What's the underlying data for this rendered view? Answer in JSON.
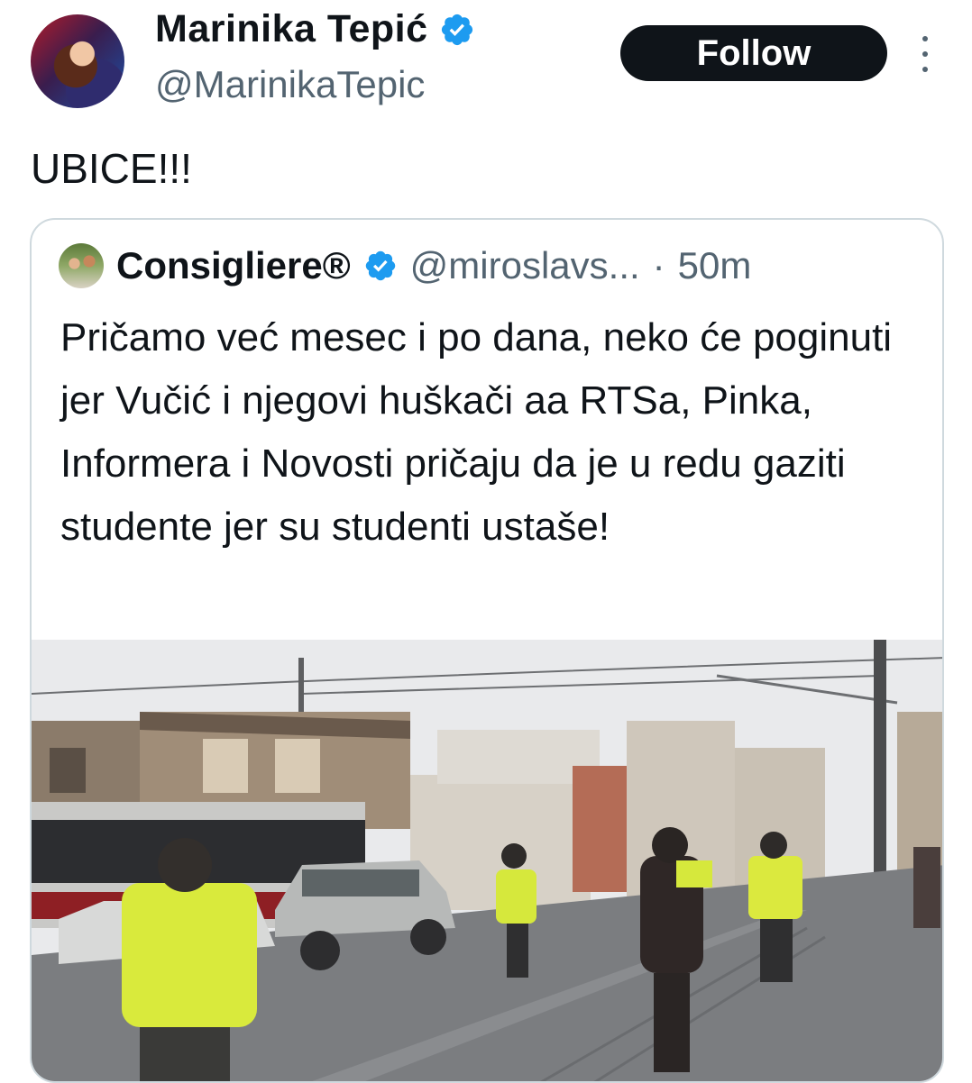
{
  "author": {
    "name": "Marinika Tepić",
    "handle": "@MarinikaTepic",
    "avatar_icon": "profile-photo",
    "verified_icon": "verified-badge-icon"
  },
  "follow_label": "Follow",
  "more_icon": "vertical-ellipsis-icon",
  "tweet_text": "UBICE!!!",
  "quoted_tweet": {
    "name": "Consigliere®",
    "handle": "@miroslavs...",
    "separator": "·",
    "time": "50m",
    "text": "Pričamo već mesec i po dana, neko će poginuti jer Vučić i njegovi huškači aa RTSa, Pinka, Informera i Novosti pričaju da je u redu gaziti studente jer su studenti ustaše!",
    "media_icon": "street-video-thumbnail"
  },
  "colors": {
    "verified_blue": "#1d9bf0",
    "secondary_text": "#536471",
    "follow_bg": "#0f1419",
    "border": "#cfd9de"
  }
}
